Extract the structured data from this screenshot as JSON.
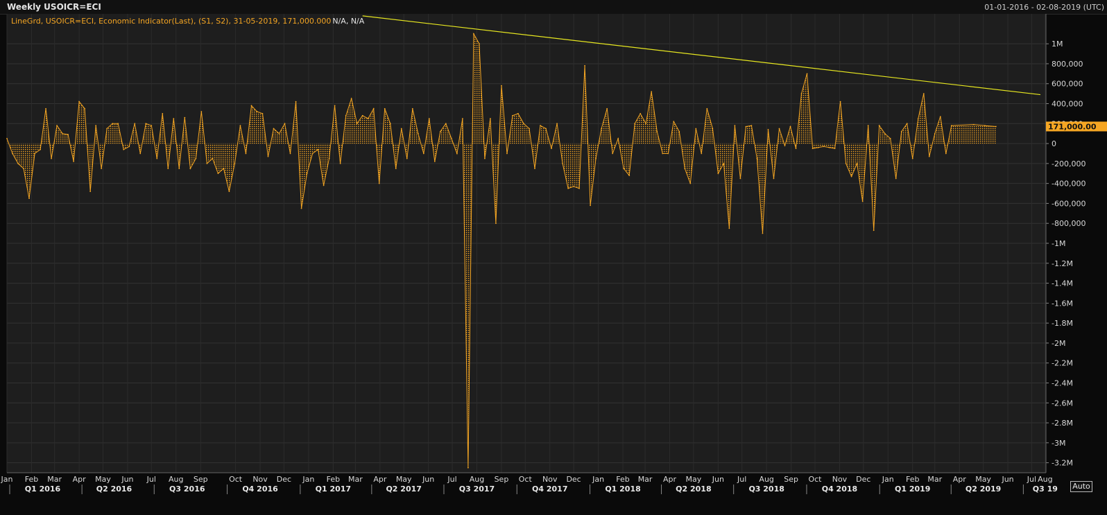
{
  "window": {
    "title": "Weekly USOICR=ECI",
    "date_range": "01-01-2016 - 02-08-2019 (UTC)",
    "auto_label": "Auto"
  },
  "legend": {
    "series": "LineGrd, USOICR=ECI, Economic Indicator(Last), (S1, S2), 31-05-2019, 171,000.000",
    "extra": "N/A, N/A"
  },
  "last_value_label": "171,000.00",
  "colors": {
    "series": "#f5a623",
    "trendline": "#e8e820",
    "background": "#1e1e1e",
    "grid": "#333333",
    "last_badge": "#f5a623"
  },
  "chart_data": {
    "type": "area",
    "title": "Weekly USOICR=ECI",
    "ylim": [
      -3300000,
      1300000
    ],
    "y_tick_labels": [
      "1M",
      "800,000",
      "600,000",
      "400,000",
      "200,000",
      "0",
      "-200,000",
      "-400,000",
      "-600,000",
      "-800,000",
      "-1M",
      "-1.2M",
      "-1.4M",
      "-1.6M",
      "-1.8M",
      "-2M",
      "-2.2M",
      "-2.4M",
      "-2.6M",
      "-2.8M",
      "-3M",
      "-3.2M"
    ],
    "y_tick_values": [
      1000000,
      800000,
      600000,
      400000,
      200000,
      0,
      -200000,
      -400000,
      -600000,
      -800000,
      -1000000,
      -1200000,
      -1400000,
      -1600000,
      -1800000,
      -2000000,
      -2200000,
      -2400000,
      -2600000,
      -2800000,
      -3000000,
      -3200000
    ],
    "x_range": [
      "2016-01-01",
      "2019-08-02"
    ],
    "month_ticks": [
      {
        "label": "Jan",
        "date": "2016-01-01"
      },
      {
        "label": "Feb",
        "date": "2016-02-01"
      },
      {
        "label": "Mar",
        "date": "2016-03-01"
      },
      {
        "label": "Apr",
        "date": "2016-04-01"
      },
      {
        "label": "May",
        "date": "2016-05-01"
      },
      {
        "label": "Jun",
        "date": "2016-06-01"
      },
      {
        "label": "Jul",
        "date": "2016-07-01"
      },
      {
        "label": "Aug",
        "date": "2016-08-01"
      },
      {
        "label": "Sep",
        "date": "2016-09-01"
      },
      {
        "label": "Oct",
        "date": "2016-10-15"
      },
      {
        "label": "Nov",
        "date": "2016-11-15"
      },
      {
        "label": "Dec",
        "date": "2016-12-15"
      },
      {
        "label": "Jan",
        "date": "2017-01-15"
      },
      {
        "label": "Feb",
        "date": "2017-02-15"
      },
      {
        "label": "Mar",
        "date": "2017-03-15"
      },
      {
        "label": "Apr",
        "date": "2017-04-15"
      },
      {
        "label": "May",
        "date": "2017-05-15"
      },
      {
        "label": "Jun",
        "date": "2017-06-15"
      },
      {
        "label": "Jul",
        "date": "2017-07-15"
      },
      {
        "label": "Aug",
        "date": "2017-08-15"
      },
      {
        "label": "Sep",
        "date": "2017-09-15"
      },
      {
        "label": "Oct",
        "date": "2017-10-15"
      },
      {
        "label": "Nov",
        "date": "2017-11-15"
      },
      {
        "label": "Dec",
        "date": "2017-12-15"
      },
      {
        "label": "Jan",
        "date": "2018-01-15"
      },
      {
        "label": "Feb",
        "date": "2018-02-15"
      },
      {
        "label": "Mar",
        "date": "2018-03-15"
      },
      {
        "label": "Apr",
        "date": "2018-04-15"
      },
      {
        "label": "May",
        "date": "2018-05-15"
      },
      {
        "label": "Jun",
        "date": "2018-06-15"
      },
      {
        "label": "Jul",
        "date": "2018-07-15"
      },
      {
        "label": "Aug",
        "date": "2018-08-15"
      },
      {
        "label": "Sep",
        "date": "2018-09-15"
      },
      {
        "label": "Oct",
        "date": "2018-10-15"
      },
      {
        "label": "Nov",
        "date": "2018-11-15"
      },
      {
        "label": "Dec",
        "date": "2018-12-15"
      },
      {
        "label": "Jan",
        "date": "2019-01-15"
      },
      {
        "label": "Feb",
        "date": "2019-02-15"
      },
      {
        "label": "Mar",
        "date": "2019-03-15"
      },
      {
        "label": "Apr",
        "date": "2019-04-15"
      },
      {
        "label": "May",
        "date": "2019-05-15"
      },
      {
        "label": "Jun",
        "date": "2019-06-15"
      },
      {
        "label": "Jul",
        "date": "2019-07-15"
      },
      {
        "label": "Aug",
        "date": "2019-08-01"
      }
    ],
    "quarter_ticks": [
      {
        "label": "Q1 2016",
        "date": "2016-02-15"
      },
      {
        "label": "Q2 2016",
        "date": "2016-05-15"
      },
      {
        "label": "Q3 2016",
        "date": "2016-08-15"
      },
      {
        "label": "Q4 2016",
        "date": "2016-11-15"
      },
      {
        "label": "Q1 2017",
        "date": "2017-02-15"
      },
      {
        "label": "Q2 2017",
        "date": "2017-05-15"
      },
      {
        "label": "Q3 2017",
        "date": "2017-08-15"
      },
      {
        "label": "Q4 2017",
        "date": "2017-11-15"
      },
      {
        "label": "Q1 2018",
        "date": "2018-02-15"
      },
      {
        "label": "Q2 2018",
        "date": "2018-05-15"
      },
      {
        "label": "Q3 2018",
        "date": "2018-08-15"
      },
      {
        "label": "Q4 2018",
        "date": "2018-11-15"
      },
      {
        "label": "Q1 2019",
        "date": "2019-02-15"
      },
      {
        "label": "Q2 2019",
        "date": "2019-05-15"
      },
      {
        "label": "Q3 19",
        "date": "2019-08-01"
      }
    ],
    "series": [
      {
        "values": [
          [
            "2016-01-01",
            50000
          ],
          [
            "2016-01-08",
            -100000
          ],
          [
            "2016-01-15",
            -200000
          ],
          [
            "2016-01-22",
            -250000
          ],
          [
            "2016-01-29",
            -550000
          ],
          [
            "2016-02-05",
            -100000
          ],
          [
            "2016-02-12",
            -60000
          ],
          [
            "2016-02-19",
            350000
          ],
          [
            "2016-02-26",
            -150000
          ],
          [
            "2016-03-04",
            180000
          ],
          [
            "2016-03-11",
            100000
          ],
          [
            "2016-03-18",
            90000
          ],
          [
            "2016-03-25",
            -180000
          ],
          [
            "2016-04-01",
            420000
          ],
          [
            "2016-04-08",
            350000
          ],
          [
            "2016-04-15",
            -480000
          ],
          [
            "2016-04-22",
            180000
          ],
          [
            "2016-04-29",
            -250000
          ],
          [
            "2016-05-06",
            150000
          ],
          [
            "2016-05-13",
            200000
          ],
          [
            "2016-05-20",
            200000
          ],
          [
            "2016-05-27",
            -60000
          ],
          [
            "2016-06-03",
            -30000
          ],
          [
            "2016-06-10",
            200000
          ],
          [
            "2016-06-17",
            -100000
          ],
          [
            "2016-06-24",
            200000
          ],
          [
            "2016-07-01",
            180000
          ],
          [
            "2016-07-08",
            -150000
          ],
          [
            "2016-07-15",
            300000
          ],
          [
            "2016-07-22",
            -250000
          ],
          [
            "2016-07-29",
            250000
          ],
          [
            "2016-08-05",
            -250000
          ],
          [
            "2016-08-12",
            260000
          ],
          [
            "2016-08-19",
            -250000
          ],
          [
            "2016-08-26",
            -150000
          ],
          [
            "2016-09-02",
            320000
          ],
          [
            "2016-09-09",
            -200000
          ],
          [
            "2016-09-16",
            -150000
          ],
          [
            "2016-09-23",
            -300000
          ],
          [
            "2016-09-30",
            -250000
          ],
          [
            "2016-10-07",
            -480000
          ],
          [
            "2016-10-14",
            -200000
          ],
          [
            "2016-10-21",
            180000
          ],
          [
            "2016-10-28",
            -100000
          ],
          [
            "2016-11-04",
            380000
          ],
          [
            "2016-11-11",
            320000
          ],
          [
            "2016-11-18",
            300000
          ],
          [
            "2016-11-25",
            -130000
          ],
          [
            "2016-12-02",
            150000
          ],
          [
            "2016-12-09",
            100000
          ],
          [
            "2016-12-16",
            200000
          ],
          [
            "2016-12-23",
            -100000
          ],
          [
            "2016-12-30",
            420000
          ],
          [
            "2017-01-06",
            -650000
          ],
          [
            "2017-01-13",
            -300000
          ],
          [
            "2017-01-20",
            -100000
          ],
          [
            "2017-01-27",
            -60000
          ],
          [
            "2017-02-03",
            -420000
          ],
          [
            "2017-02-10",
            -150000
          ],
          [
            "2017-02-17",
            380000
          ],
          [
            "2017-02-24",
            -200000
          ],
          [
            "2017-03-03",
            280000
          ],
          [
            "2017-03-10",
            450000
          ],
          [
            "2017-03-17",
            200000
          ],
          [
            "2017-03-24",
            280000
          ],
          [
            "2017-03-31",
            250000
          ],
          [
            "2017-04-07",
            350000
          ],
          [
            "2017-04-14",
            -400000
          ],
          [
            "2017-04-21",
            350000
          ],
          [
            "2017-04-28",
            200000
          ],
          [
            "2017-05-05",
            -250000
          ],
          [
            "2017-05-12",
            150000
          ],
          [
            "2017-05-19",
            -150000
          ],
          [
            "2017-05-26",
            350000
          ],
          [
            "2017-06-02",
            100000
          ],
          [
            "2017-06-09",
            -100000
          ],
          [
            "2017-06-16",
            250000
          ],
          [
            "2017-06-23",
            -180000
          ],
          [
            "2017-06-30",
            120000
          ],
          [
            "2017-07-07",
            200000
          ],
          [
            "2017-07-14",
            50000
          ],
          [
            "2017-07-21",
            -100000
          ],
          [
            "2017-07-28",
            250000
          ],
          [
            "2017-08-04",
            -3250000
          ],
          [
            "2017-08-11",
            1100000
          ],
          [
            "2017-08-18",
            1000000
          ],
          [
            "2017-08-25",
            -150000
          ],
          [
            "2017-09-01",
            250000
          ],
          [
            "2017-09-08",
            -800000
          ],
          [
            "2017-09-15",
            580000
          ],
          [
            "2017-09-22",
            -100000
          ],
          [
            "2017-09-29",
            280000
          ],
          [
            "2017-10-06",
            300000
          ],
          [
            "2017-10-13",
            200000
          ],
          [
            "2017-10-20",
            150000
          ],
          [
            "2017-10-27",
            -250000
          ],
          [
            "2017-11-03",
            180000
          ],
          [
            "2017-11-10",
            150000
          ],
          [
            "2017-11-17",
            -50000
          ],
          [
            "2017-11-24",
            200000
          ],
          [
            "2017-12-01",
            -200000
          ],
          [
            "2017-12-08",
            -450000
          ],
          [
            "2017-12-15",
            -430000
          ],
          [
            "2017-12-22",
            -450000
          ],
          [
            "2017-12-29",
            780000
          ],
          [
            "2018-01-05",
            -620000
          ],
          [
            "2018-01-12",
            -150000
          ],
          [
            "2018-01-19",
            150000
          ],
          [
            "2018-01-26",
            350000
          ],
          [
            "2018-02-02",
            -100000
          ],
          [
            "2018-02-09",
            50000
          ],
          [
            "2018-02-16",
            -250000
          ],
          [
            "2018-02-23",
            -320000
          ],
          [
            "2018-03-02",
            200000
          ],
          [
            "2018-03-09",
            300000
          ],
          [
            "2018-03-16",
            200000
          ],
          [
            "2018-03-23",
            520000
          ],
          [
            "2018-03-30",
            120000
          ],
          [
            "2018-04-06",
            -100000
          ],
          [
            "2018-04-13",
            -100000
          ],
          [
            "2018-04-20",
            220000
          ],
          [
            "2018-04-27",
            120000
          ],
          [
            "2018-05-04",
            -250000
          ],
          [
            "2018-05-11",
            -400000
          ],
          [
            "2018-05-18",
            150000
          ],
          [
            "2018-05-25",
            -100000
          ],
          [
            "2018-06-01",
            350000
          ],
          [
            "2018-06-08",
            150000
          ],
          [
            "2018-06-15",
            -300000
          ],
          [
            "2018-06-22",
            -200000
          ],
          [
            "2018-06-29",
            -850000
          ],
          [
            "2018-07-06",
            180000
          ],
          [
            "2018-07-13",
            -350000
          ],
          [
            "2018-07-20",
            170000
          ],
          [
            "2018-07-27",
            180000
          ],
          [
            "2018-08-03",
            -150000
          ],
          [
            "2018-08-10",
            -900000
          ],
          [
            "2018-08-17",
            140000
          ],
          [
            "2018-08-24",
            -350000
          ],
          [
            "2018-08-31",
            150000
          ],
          [
            "2018-09-07",
            -20000
          ],
          [
            "2018-09-14",
            170000
          ],
          [
            "2018-09-21",
            -50000
          ],
          [
            "2018-09-28",
            500000
          ],
          [
            "2018-10-05",
            700000
          ],
          [
            "2018-10-12",
            -50000
          ],
          [
            "2018-10-19",
            -40000
          ],
          [
            "2018-10-26",
            -30000
          ],
          [
            "2018-11-02",
            -40000
          ],
          [
            "2018-11-09",
            -50000
          ],
          [
            "2018-11-16",
            420000
          ],
          [
            "2018-11-23",
            -200000
          ],
          [
            "2018-11-30",
            -330000
          ],
          [
            "2018-12-07",
            -200000
          ],
          [
            "2018-12-14",
            -580000
          ],
          [
            "2018-12-21",
            180000
          ],
          [
            "2018-12-28",
            -870000
          ],
          [
            "2019-01-04",
            180000
          ],
          [
            "2019-01-11",
            100000
          ],
          [
            "2019-01-18",
            50000
          ],
          [
            "2019-01-25",
            -350000
          ],
          [
            "2019-02-01",
            120000
          ],
          [
            "2019-02-08",
            200000
          ],
          [
            "2019-02-15",
            -150000
          ],
          [
            "2019-02-22",
            250000
          ],
          [
            "2019-03-01",
            500000
          ],
          [
            "2019-03-08",
            -130000
          ],
          [
            "2019-03-15",
            100000
          ],
          [
            "2019-03-22",
            270000
          ],
          [
            "2019-03-29",
            -100000
          ],
          [
            "2019-04-05",
            180000
          ],
          [
            "2019-05-03",
            190000
          ],
          [
            "2019-05-17",
            180000
          ],
          [
            "2019-05-31",
            171000
          ]
        ]
      }
    ],
    "trendline": {
      "start": [
        "2017-03-24",
        1280000
      ],
      "end": [
        "2019-07-26",
        490000
      ]
    }
  }
}
